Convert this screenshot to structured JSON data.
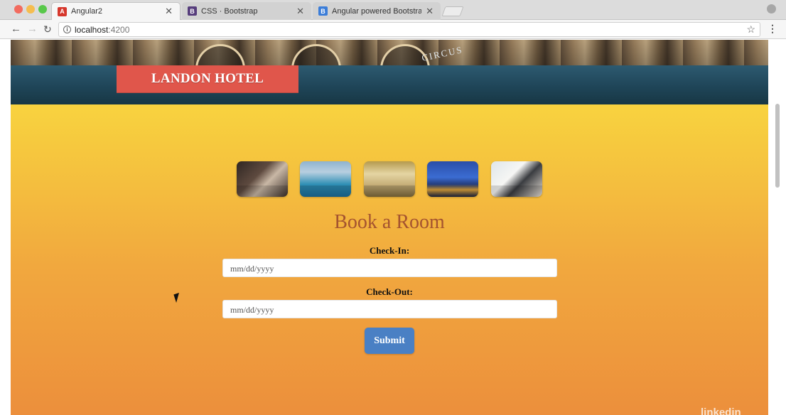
{
  "browser": {
    "tabs": [
      {
        "label": "Angular2",
        "favicon": "A",
        "favicon_color": "#d6372c",
        "active": true
      },
      {
        "label": "CSS · Bootstrap",
        "favicon": "B",
        "favicon_color": "#563d7c",
        "active": false
      },
      {
        "label": "Angular powered Bootstrap",
        "favicon": "B",
        "favicon_color": "#3b7dd8",
        "active": false
      }
    ],
    "url_host": "localhost",
    "url_port": ":4200"
  },
  "header": {
    "hero_sign": "CIRCUS",
    "logo": "LANDON HOTEL"
  },
  "gallery": {
    "thumbnails": [
      "bedroom-photo",
      "pool-photo",
      "dining-hall-photo",
      "london-night-photo",
      "wedding-photo"
    ]
  },
  "booking_form": {
    "title": "Book a Room",
    "checkin_label": "Check-In:",
    "checkin_placeholder": "mm/dd/yyyy",
    "checkout_label": "Check-Out:",
    "checkout_placeholder": "mm/dd/yyyy",
    "submit_label": "Submit"
  },
  "colors": {
    "logo_bg": "#e0564b",
    "header_band": "#1f4558",
    "gradient_top": "#f8d33f",
    "gradient_bottom": "#ec8f3c",
    "title": "#a4532f",
    "submit_bg": "#4a80c4"
  },
  "watermark": "linkedin"
}
